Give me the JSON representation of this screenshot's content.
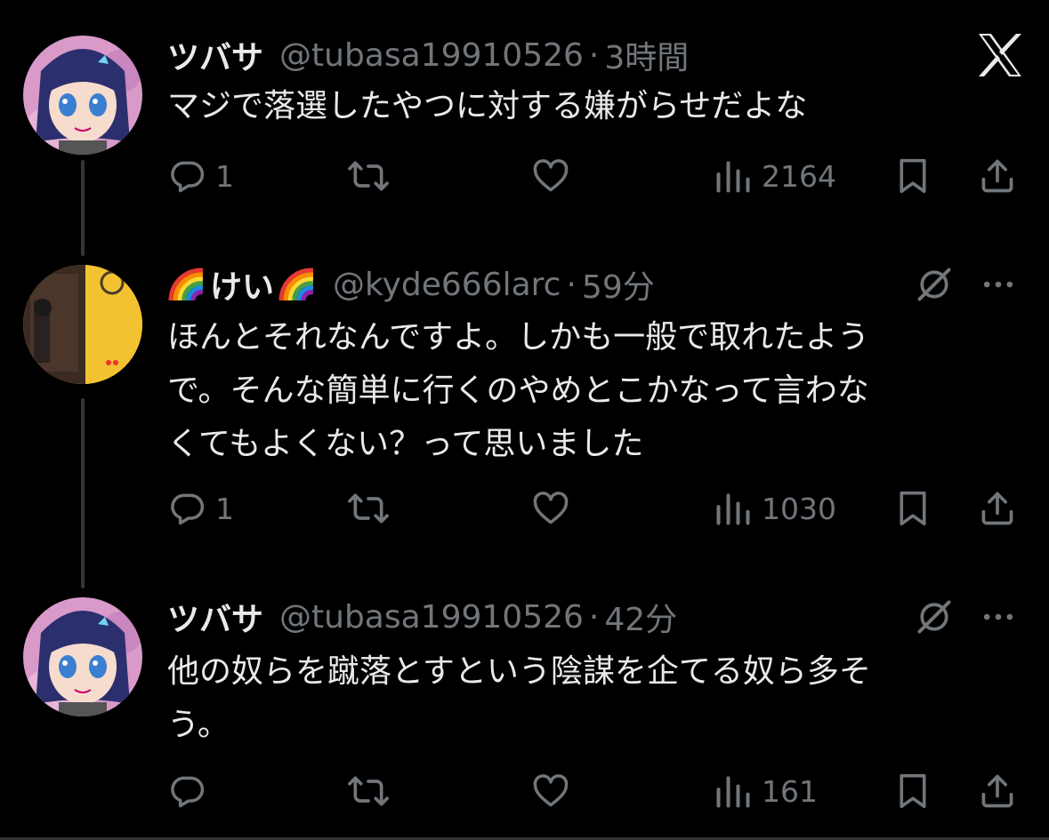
{
  "tweets": [
    {
      "name": "ツバサ",
      "handle": "@tubasa19910526",
      "separator": "·",
      "time": "3時間",
      "text": "マジで落選したやつに対する嫌がらせだよな",
      "replies": "1",
      "retweets": "",
      "likes": "",
      "views": "2164",
      "avatar": "anime-girl-avatar"
    },
    {
      "name_prefix_icon": "rainbow-icon",
      "name": "けい",
      "name_suffix_icon": "rainbow-icon",
      "handle": "@kyde666larc",
      "separator": "·",
      "time": "59分",
      "text_lines": [
        "ほんとそれなんですよ。しかも一般で取れたよう",
        "で。そんな簡単に行くのやめとこかなって言わな",
        "くてもよくない？って思いました"
      ],
      "replies": "1",
      "retweets": "",
      "likes": "",
      "views": "1030",
      "avatar": "door-photo-avatar"
    },
    {
      "name": "ツバサ",
      "handle": "@tubasa19910526",
      "separator": "·",
      "time": "42分",
      "text_lines": [
        "他の奴らを蹴落とすという陰謀を企てる奴ら多そ",
        "う。"
      ],
      "replies": "",
      "retweets": "",
      "likes": "",
      "views": "161",
      "avatar": "anime-girl-avatar"
    }
  ],
  "icons": {
    "close": "x-logo-icon",
    "grok": "grok-icon",
    "more": "more-icon",
    "reply": "reply-icon",
    "retweet": "retweet-icon",
    "like": "heart-icon",
    "views": "views-icon",
    "bookmark": "bookmark-icon",
    "share": "share-icon"
  },
  "colors": {
    "background": "#000000",
    "text": "#e7e9ea",
    "secondary": "#71767b",
    "thread_line": "#333639"
  }
}
